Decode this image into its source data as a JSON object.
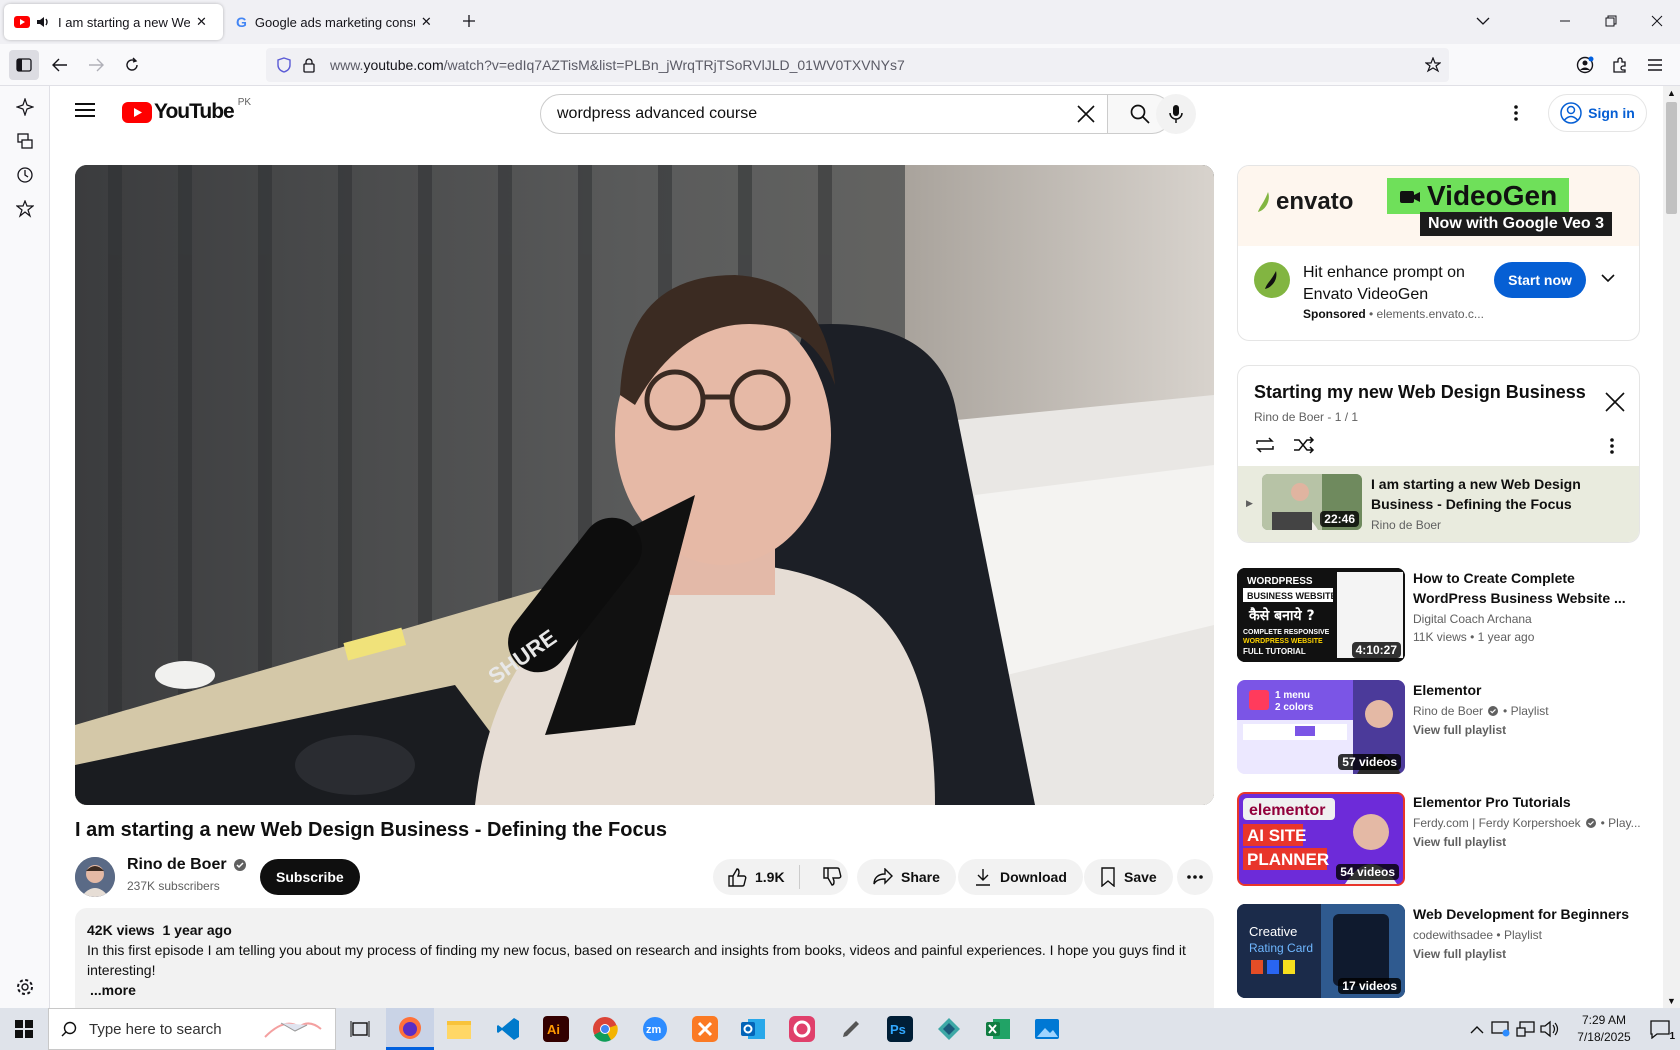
{
  "browser": {
    "tabs": [
      {
        "title": "I am starting a new Web Design Business - Defining the Focus",
        "active": true
      },
      {
        "title": "Google ads marketing consultant",
        "active": false
      }
    ],
    "url_prefix": "www.",
    "url_host": "youtube.com",
    "url_path": "/watch?v=edIq7AZTisM&list=PLBn_jWrqTRjTSoRVlJLD_01WV0TXVNYs7"
  },
  "youtube": {
    "logo_text": "YouTube",
    "region": "PK",
    "search_value": "wordpress advanced course",
    "signin_label": "Sign in"
  },
  "video": {
    "title": "I am starting a new Web Design Business - Defining the Focus",
    "channel": "Rino de Boer",
    "subscribers": "237K subscribers",
    "subscribe_label": "Subscribe",
    "likes": "1.9K",
    "share_label": "Share",
    "download_label": "Download",
    "save_label": "Save",
    "views": "42K views",
    "age": "1 year ago",
    "description": "In this first episode I am telling you about my process of finding my new focus, based on research and insights from books, videos and painful experiences. I hope you guys find it interesting!",
    "more_label": "...more"
  },
  "ad": {
    "brand": "envato",
    "product": "VideoGen",
    "tagline": "Now with Google Veo 3",
    "headline": "Hit enhance prompt on Envato VideoGen",
    "sponsored": "Sponsored",
    "domain": "elements.envato.c...",
    "cta": "Start now"
  },
  "playlist": {
    "title": "Starting my new Web Design Business",
    "meta": "Rino de Boer - 1 / 1",
    "item_title": "I am starting a new Web Design Business - Defining the Focus",
    "item_channel": "Rino de Boer",
    "item_duration": "22:46"
  },
  "recommendations": [
    {
      "title": "How to Create Complete WordPress Business Website ...",
      "channel": "Digital Coach Archana",
      "meta": "11K views • 1 year ago",
      "badge": "4:10:27",
      "thumb_text": [
        "WORDPRESS",
        "BUSINESS WEBSITE",
        "कैसे बनाये ?",
        "COMPLETE RESPONSIVE",
        "WORDPRESS WEBSITE",
        "FULL TUTORIAL"
      ],
      "colors": [
        "#111111",
        "#ffffff"
      ]
    },
    {
      "title": "Elementor",
      "channel": "Rino de Boer",
      "meta": "• Playlist",
      "extra": "View full playlist",
      "badge": "57 videos",
      "thumb_text": [
        "1 menu",
        "2 colors"
      ],
      "colors": [
        "#7b55e6",
        "#ece8ff"
      ]
    },
    {
      "title": "Elementor Pro Tutorials",
      "channel": "Ferdy.com | Ferdy Korpershoek",
      "meta": "• Play...",
      "extra": "View full playlist",
      "badge": "54 videos",
      "thumb_text": [
        "elementor",
        "AI SITE",
        "PLANNER"
      ],
      "colors": [
        "#6d2bd9",
        "#e8352b"
      ]
    },
    {
      "title": "Web Development for Beginners",
      "channel": "codewithsadee",
      "meta": "• Playlist",
      "extra": "View full playlist",
      "badge": "17 videos",
      "thumb_text": [
        "Creative",
        "Rating Card"
      ],
      "colors": [
        "#1b2b4a",
        "#2f5a8f"
      ]
    }
  ],
  "taskbar": {
    "search_placeholder": "Type here to search",
    "time": "7:29 AM",
    "date": "7/18/2025",
    "notification_count": "1"
  },
  "icon_colors": {
    "youtube_red": "#ff0000",
    "link_blue": "#065fd4",
    "envato_green": "#82b541",
    "firefox_blue": "#0060df"
  }
}
